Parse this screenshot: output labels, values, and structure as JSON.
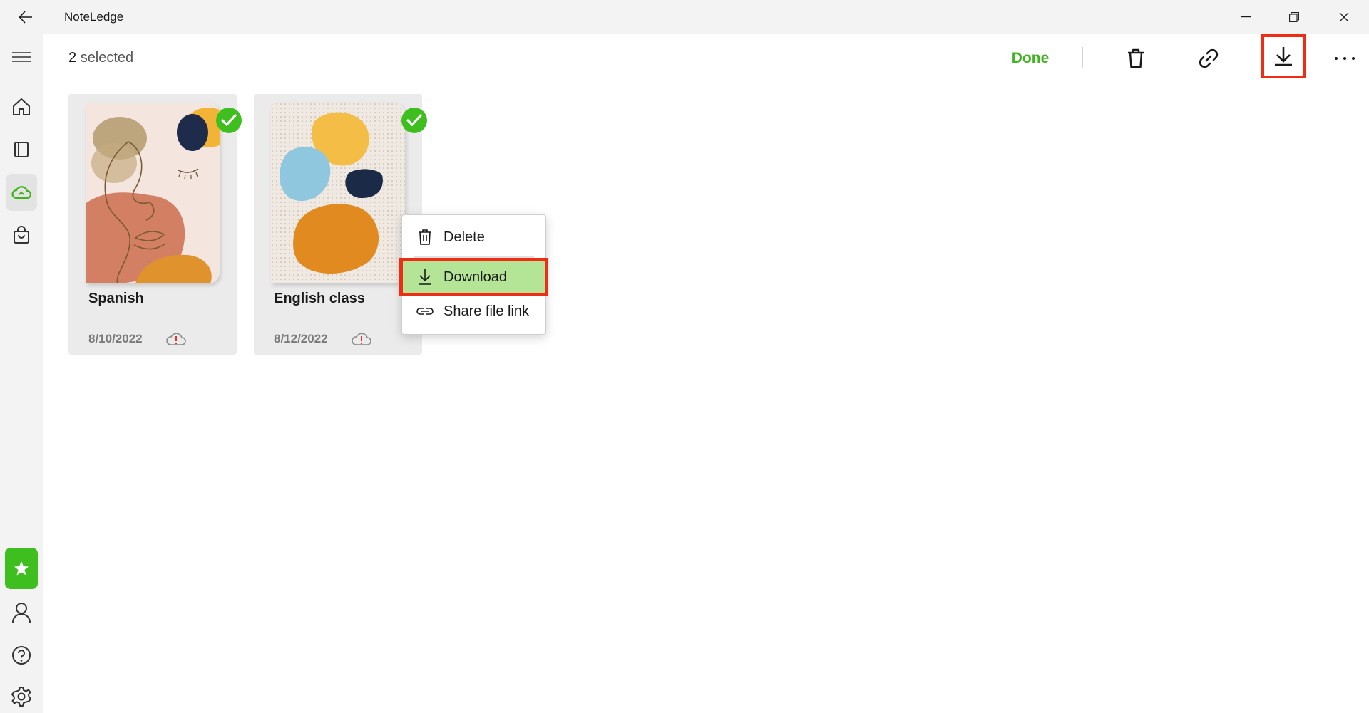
{
  "app": {
    "title": "NoteLedge"
  },
  "toolbar": {
    "selected_count": "2",
    "selected_suffix": "selected",
    "done_label": "Done"
  },
  "notebooks": [
    {
      "title": "Spanish",
      "date": "8/10/2022",
      "selected": true,
      "sync_status": "cloud-warning"
    },
    {
      "title": "English class",
      "date": "8/12/2022",
      "selected": true,
      "sync_status": "cloud-warning"
    }
  ],
  "context_menu": {
    "items": [
      {
        "label": "Delete",
        "icon": "trash-icon"
      },
      {
        "label": "Download",
        "icon": "download-icon",
        "highlighted": true
      },
      {
        "label": "Share file link",
        "icon": "link-icon"
      }
    ]
  },
  "colors": {
    "accent_green": "#3fb41f",
    "highlight_red": "#f02d14",
    "menu_hover_green": "#b4e496"
  }
}
